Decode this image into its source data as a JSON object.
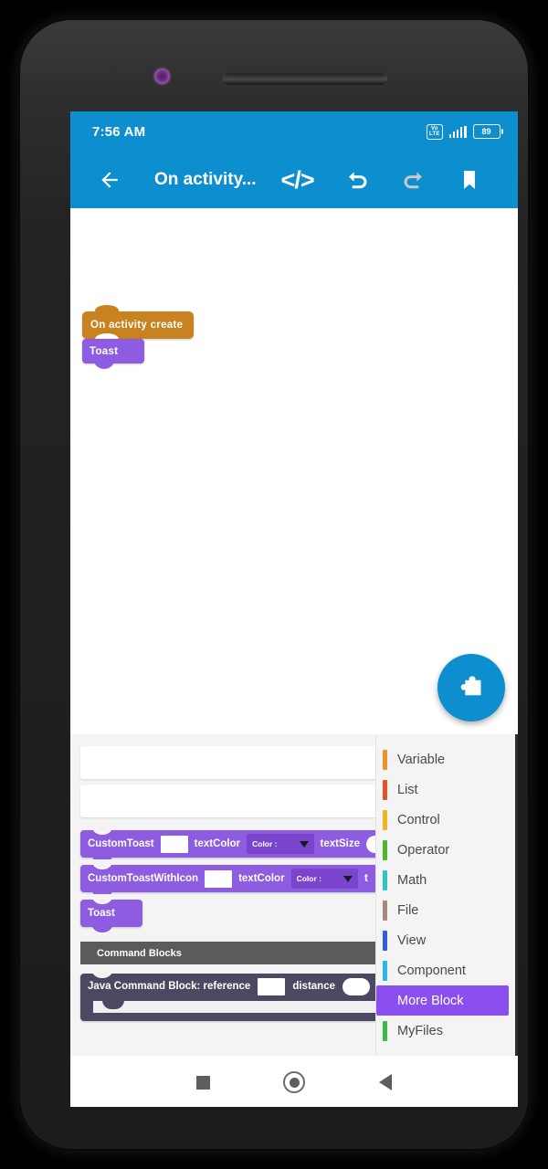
{
  "status_bar": {
    "time": "7:56 AM",
    "network_badge_top": "Vo",
    "network_badge_bottom": "LTE",
    "battery_percent": "89",
    "signal_icon": "signal-bars-icon"
  },
  "toolbar": {
    "back_icon": "back-arrow-icon",
    "title": "On activity...",
    "code_icon": "</>",
    "undo_icon": "undo-icon",
    "redo_icon": "redo-icon",
    "bookmark_icon": "bookmark-icon",
    "accent_color": "#0d8ecf",
    "redo_disabled_color": "#c8c8c8"
  },
  "canvas": {
    "blocks": [
      {
        "label": "On  activity  create",
        "color": "#c8821f",
        "kind": "event-block"
      },
      {
        "label": "Toast",
        "color": "#8e5ce0",
        "kind": "command-block"
      }
    ],
    "fab_icon": "puzzle-piece-icon",
    "fab_color": "#0d8ecf"
  },
  "palette": {
    "card_rows": [
      "",
      ""
    ],
    "blocks": [
      {
        "name": "CustomToast",
        "label": "CustomToast",
        "field_text": "",
        "arg1_label": "textColor",
        "dropdown_label": "Color :",
        "arg2_label": "textSize",
        "color": "#8e5ce0"
      },
      {
        "name": "CustomToastWithIcon",
        "label": "CustomToastWithIcon",
        "field_text": "",
        "arg1_label": "textColor",
        "dropdown_label": "Color :",
        "arg2_label": "t",
        "color": "#8e5ce0"
      },
      {
        "name": "Toast",
        "label": "Toast",
        "color": "#8e5ce0"
      }
    ],
    "section_header": "Command Blocks",
    "java_block": {
      "label": "Java  Command  Block: reference",
      "field_text": "",
      "arg_label": "distance",
      "color": "#4e4762"
    }
  },
  "categories": [
    {
      "label": "Variable",
      "color": "#f3902a",
      "selected": false
    },
    {
      "label": "List",
      "color": "#e0522a",
      "selected": false
    },
    {
      "label": "Control",
      "color": "#f0b429",
      "selected": false
    },
    {
      "label": "Operator",
      "color": "#4cb82c",
      "selected": false
    },
    {
      "label": "Math",
      "color": "#2fc2c6",
      "selected": false
    },
    {
      "label": "File",
      "color": "#a9887c",
      "selected": false
    },
    {
      "label": "View",
      "color": "#2f5fe0",
      "selected": false
    },
    {
      "label": "Component",
      "color": "#29b6f0",
      "selected": false
    },
    {
      "label": "More Block",
      "color": "#8b4ff0",
      "selected": true
    },
    {
      "label": "MyFiles",
      "color": "#3aba4a",
      "selected": false
    }
  ],
  "nav_bar": {
    "recents_icon": "square-recents-icon",
    "home_icon": "circle-home-icon",
    "back_icon": "triangle-back-icon"
  }
}
